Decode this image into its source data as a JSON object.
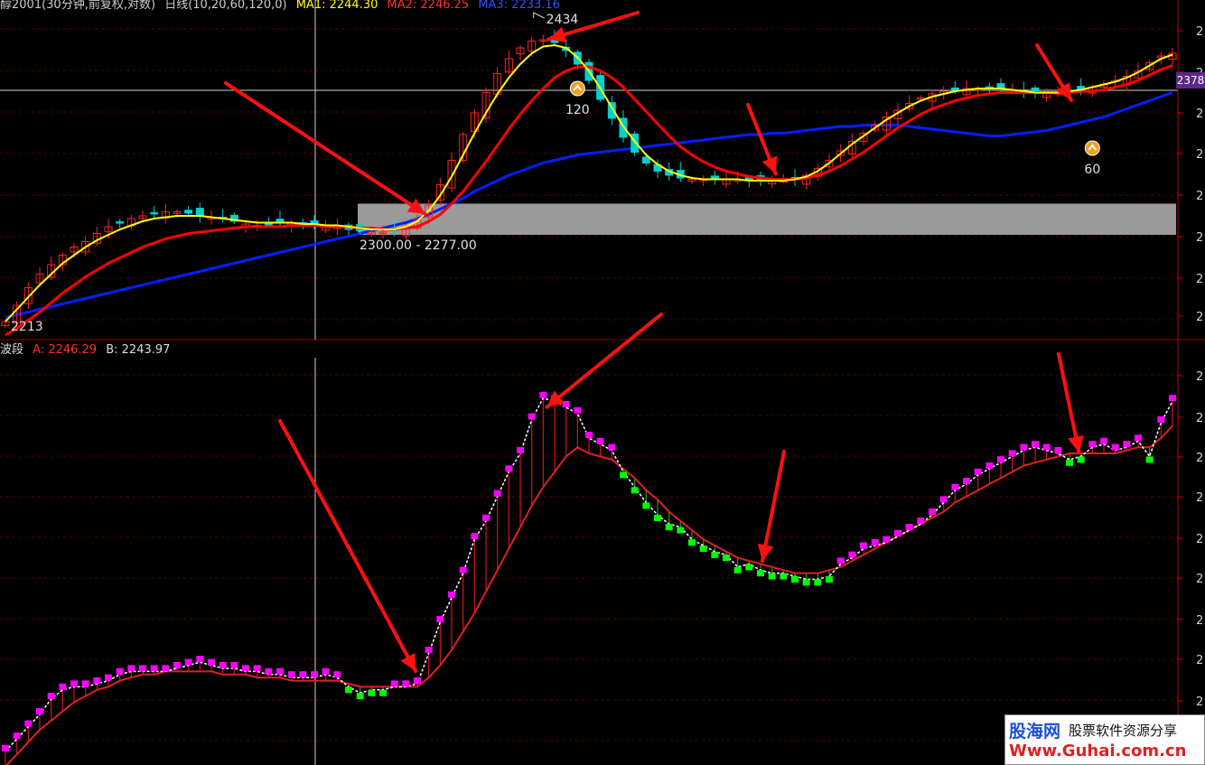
{
  "header_top": {
    "instrument": "醇2001(30分钟,前复权,对数)",
    "indicator": "日线(10,20,60,120,0)",
    "ma1": "MA1: 2244.30",
    "ma2": "MA2: 2246.25",
    "ma3": "MA3: 2233.16"
  },
  "header_bottom": {
    "indicator": "波段",
    "a": "A: 2246.29",
    "b": "B: 2243.97"
  },
  "price_tag": "2378",
  "colors": {
    "ma1": "#ffff00",
    "ma2": "#ff0000",
    "ma3": "#0020ff",
    "up": "#ff2020",
    "down": "#00d0d0",
    "osc_up": "#ff00ff",
    "osc_down": "#00ff00",
    "fill_up": "#c81c1c",
    "fill_down": "#1ea01e",
    "arrow": "#ff1010",
    "box": "#9a9a9a",
    "axis": "#c00000"
  },
  "chart_data": [
    {
      "type": "candlestick",
      "panel": "price",
      "annotations": {
        "high_label": "2434",
        "low_label": "2213",
        "box_label": "2300.00 - 2277.00",
        "marker_1": "120",
        "marker_2": "60"
      },
      "box": {
        "low": 2277,
        "high": 2300
      },
      "ylim": [
        2205,
        2445
      ],
      "close": [
        2213,
        2225,
        2238,
        2248,
        2255,
        2262,
        2268,
        2272,
        2278,
        2283,
        2286,
        2289,
        2291,
        2293,
        2294,
        2294,
        2293,
        2291,
        2290,
        2289,
        2287,
        2285,
        2284,
        2285,
        2286,
        2286,
        2285,
        2284,
        2283,
        2283,
        2281,
        2280,
        2279,
        2279,
        2280,
        2283,
        2289,
        2299,
        2314,
        2332,
        2351,
        2367,
        2382,
        2396,
        2407,
        2415,
        2420,
        2421,
        2419,
        2413,
        2403,
        2391,
        2377,
        2363,
        2349,
        2338,
        2330,
        2324,
        2321,
        2319,
        2318,
        2318,
        2318,
        2318,
        2318,
        2317,
        2317,
        2317,
        2317,
        2318,
        2321,
        2326,
        2332,
        2339,
        2346,
        2352,
        2358,
        2364,
        2369,
        2374,
        2378,
        2381,
        2383,
        2384,
        2385,
        2385,
        2385,
        2385,
        2384,
        2383,
        2382,
        2382,
        2382,
        2383,
        2384,
        2386,
        2388,
        2391,
        2394,
        2398,
        2404,
        2409,
        2411
      ],
      "ma1": [
        2213,
        2222,
        2231,
        2240,
        2248,
        2256,
        2262,
        2268,
        2273,
        2277,
        2281,
        2284,
        2287,
        2289,
        2290,
        2291,
        2291,
        2291,
        2290,
        2289,
        2288,
        2287,
        2286,
        2286,
        2286,
        2286,
        2285,
        2285,
        2284,
        2284,
        2283,
        2282,
        2281,
        2281,
        2281,
        2283,
        2287,
        2295,
        2306,
        2320,
        2336,
        2352,
        2367,
        2381,
        2393,
        2403,
        2411,
        2416,
        2417,
        2415,
        2408,
        2398,
        2385,
        2371,
        2357,
        2346,
        2336,
        2329,
        2324,
        2321,
        2319,
        2318,
        2318,
        2318,
        2318,
        2317,
        2317,
        2317,
        2317,
        2318,
        2320,
        2324,
        2330,
        2337,
        2344,
        2350,
        2356,
        2362,
        2367,
        2372,
        2376,
        2379,
        2381,
        2383,
        2384,
        2385,
        2385,
        2385,
        2384,
        2383,
        2382,
        2382,
        2382,
        2383,
        2384,
        2386,
        2388,
        2390,
        2393,
        2397,
        2402,
        2407,
        2410
      ],
      "ma2": [
        2203,
        2208,
        2214,
        2220,
        2227,
        2234,
        2240,
        2246,
        2251,
        2256,
        2260,
        2264,
        2268,
        2271,
        2274,
        2276,
        2278,
        2279,
        2280,
        2281,
        2282,
        2283,
        2283,
        2283,
        2283,
        2284,
        2284,
        2284,
        2283,
        2283,
        2283,
        2282,
        2282,
        2281,
        2281,
        2282,
        2283,
        2287,
        2292,
        2300,
        2309,
        2320,
        2331,
        2343,
        2355,
        2366,
        2376,
        2385,
        2393,
        2398,
        2401,
        2401,
        2398,
        2393,
        2386,
        2377,
        2368,
        2359,
        2350,
        2342,
        2336,
        2331,
        2327,
        2324,
        2322,
        2320,
        2319,
        2318,
        2318,
        2318,
        2319,
        2321,
        2324,
        2328,
        2333,
        2338,
        2344,
        2350,
        2356,
        2361,
        2366,
        2370,
        2373,
        2376,
        2378,
        2380,
        2381,
        2382,
        2382,
        2382,
        2382,
        2382,
        2382,
        2382,
        2383,
        2383,
        2384,
        2386,
        2388,
        2391,
        2395,
        2399,
        2402
      ],
      "ma3": [
        2216,
        2218,
        2220,
        2222,
        2224,
        2226,
        2228,
        2230,
        2232,
        2234,
        2236,
        2238,
        2240,
        2242,
        2244,
        2246,
        2248,
        2250,
        2252,
        2254,
        2256,
        2258,
        2260,
        2262,
        2264,
        2266,
        2268,
        2270,
        2272,
        2274,
        2276,
        2278,
        2280,
        2282,
        2284,
        2286,
        2289,
        2292,
        2296,
        2300,
        2304,
        2309,
        2313,
        2317,
        2321,
        2324,
        2327,
        2330,
        2332,
        2334,
        2336,
        2337,
        2338,
        2339,
        2340,
        2341,
        2342,
        2343,
        2344,
        2345,
        2346,
        2347,
        2348,
        2349,
        2350,
        2351,
        2351,
        2352,
        2352,
        2353,
        2354,
        2355,
        2356,
        2357,
        2357,
        2358,
        2358,
        2358,
        2358,
        2357,
        2356,
        2355,
        2354,
        2353,
        2352,
        2351,
        2350,
        2350,
        2351,
        2352,
        2353,
        2354,
        2356,
        2358,
        2360,
        2362,
        2364,
        2367,
        2370,
        2373,
        2376,
        2379,
        2382
      ],
      "markers": [
        {
          "index": 50,
          "value": 2385,
          "label_key": "marker_1"
        },
        {
          "index": 95,
          "value": 2341,
          "label_key": "marker_2"
        }
      ]
    },
    {
      "type": "area",
      "panel": "indicator",
      "series": [
        {
          "name": "A",
          "last": 2246.29
        },
        {
          "name": "B",
          "last": 2243.97
        }
      ],
      "ylim": [
        2190,
        2320
      ],
      "a": [
        2193,
        2197,
        2201,
        2205,
        2210,
        2213,
        2214,
        2214,
        2215,
        2216,
        2218,
        2219,
        2219,
        2219,
        2219,
        2220,
        2221,
        2222,
        2221,
        2220,
        2220,
        2219,
        2219,
        2218,
        2218,
        2217,
        2217,
        2217,
        2218,
        2217,
        2214,
        2212,
        2213,
        2213,
        2214,
        2214,
        2215,
        2225,
        2235,
        2243,
        2251,
        2262,
        2268,
        2276,
        2284,
        2290,
        2301,
        2308,
        2307,
        2305,
        2303,
        2295,
        2293,
        2291,
        2284,
        2279,
        2274,
        2270,
        2267,
        2266,
        2262,
        2260,
        2258,
        2257,
        2253,
        2254,
        2252,
        2251,
        2251,
        2250,
        2249,
        2249,
        2250,
        2254,
        2256,
        2259,
        2260,
        2261,
        2263,
        2265,
        2267,
        2270,
        2274,
        2278,
        2280,
        2283,
        2285,
        2287,
        2289,
        2291,
        2292,
        2291,
        2290,
        2288,
        2289,
        2292,
        2293,
        2291,
        2292,
        2294,
        2289,
        2300,
        2307
      ],
      "b": [
        2188,
        2192,
        2196,
        2200,
        2203,
        2206,
        2209,
        2211,
        2213,
        2214,
        2216,
        2217,
        2218,
        2218,
        2219,
        2219,
        2219,
        2219,
        2219,
        2218,
        2218,
        2218,
        2217,
        2217,
        2217,
        2216,
        2216,
        2216,
        2216,
        2216,
        2215,
        2214,
        2214,
        2214,
        2214,
        2214,
        2214,
        2217,
        2221,
        2226,
        2232,
        2238,
        2245,
        2252,
        2259,
        2266,
        2273,
        2279,
        2284,
        2289,
        2292,
        2290,
        2289,
        2288,
        2285,
        2282,
        2278,
        2275,
        2271,
        2268,
        2265,
        2262,
        2260,
        2258,
        2256,
        2255,
        2254,
        2253,
        2252,
        2251,
        2251,
        2251,
        2252,
        2253,
        2255,
        2257,
        2259,
        2261,
        2263,
        2265,
        2267,
        2269,
        2271,
        2274,
        2276,
        2278,
        2280,
        2282,
        2284,
        2286,
        2287,
        2288,
        2289,
        2290,
        2290,
        2290,
        2290,
        2290,
        2291,
        2292,
        2292,
        2295,
        2299
      ]
    }
  ]
}
